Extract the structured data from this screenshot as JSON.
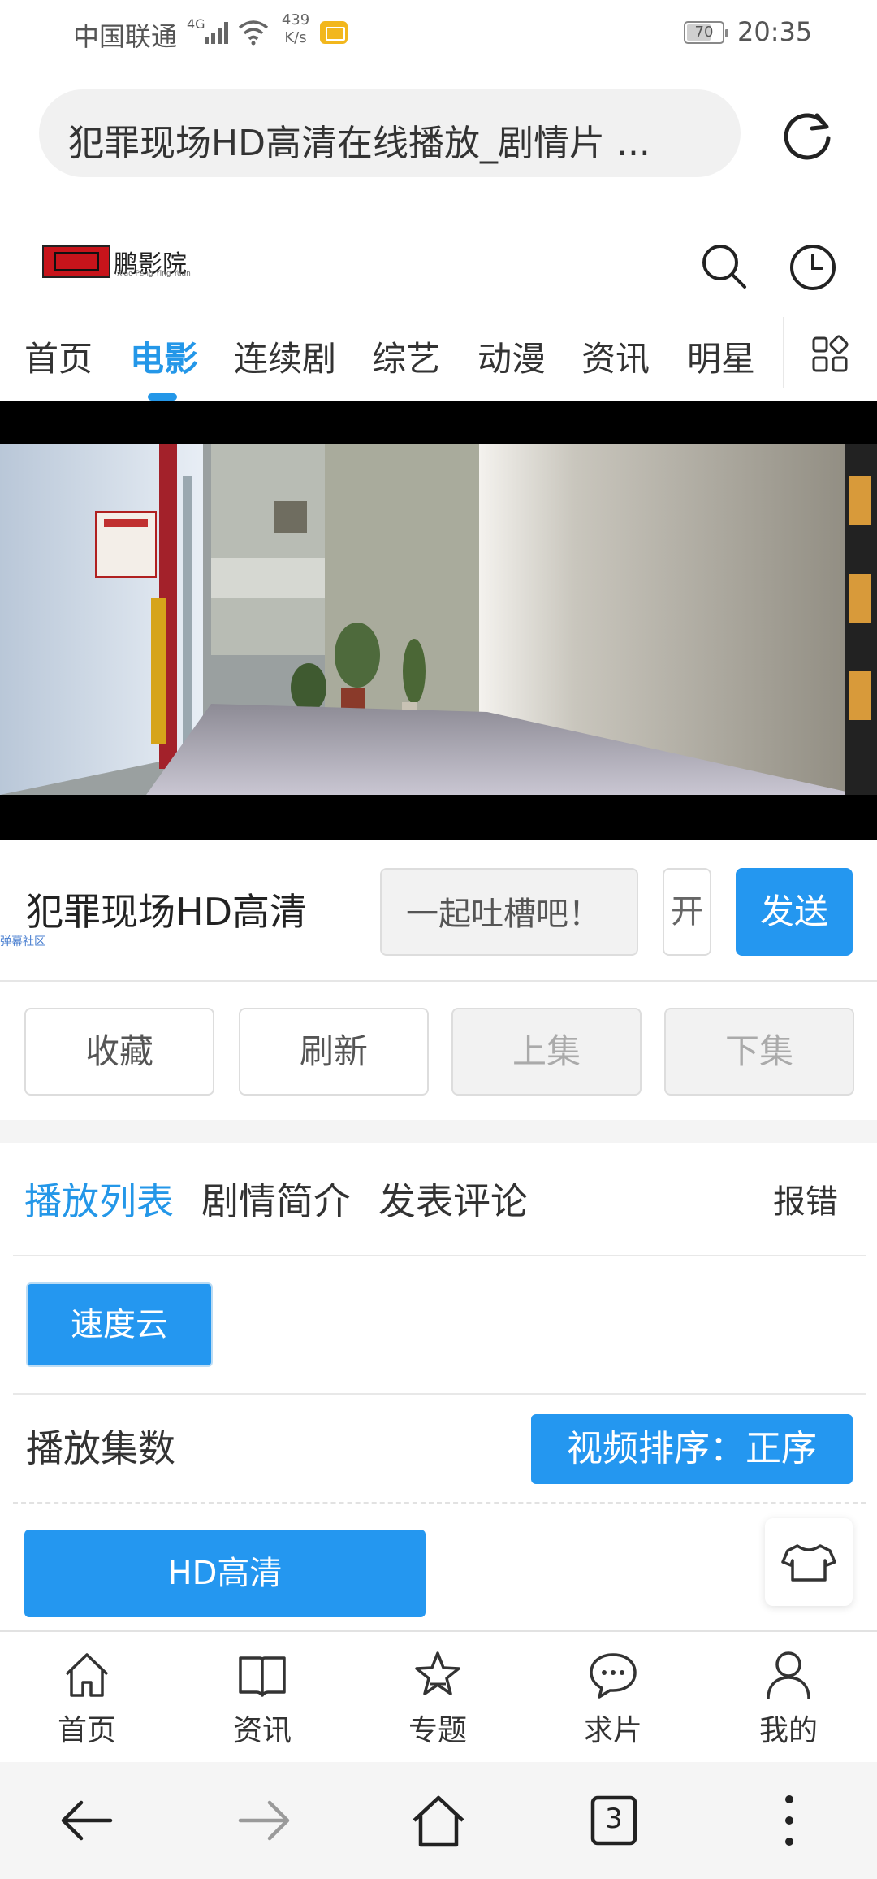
{
  "status_bar": {
    "carrier": "中国联通",
    "network": "4G",
    "speed": "439\nK/s",
    "battery": "70",
    "battery_level": 0.7,
    "time": "20:35"
  },
  "browser": {
    "address_text": "犯罪现场HD高清在线播放_剧情片 ...",
    "refresh_icon": "refresh-icon",
    "tab_count": "3"
  },
  "site": {
    "logo_text": "鹏影院",
    "logo_subtext": "Xiao Peng Ying Yuan",
    "search_icon": "search-icon",
    "history_icon": "history-icon"
  },
  "nav": {
    "items": [
      "首页",
      "电影",
      "连续剧",
      "综艺",
      "动漫",
      "资讯",
      "明星"
    ],
    "active_index": 1,
    "accent_color": "#2497e8"
  },
  "player": {
    "title": "犯罪现场HD高清",
    "danmaku_tag": "弹幕社区",
    "danmaku_placeholder": "一起吐槽吧！",
    "danmaku_toggle": "开",
    "send_label": "发送"
  },
  "actions": {
    "favorite": "收藏",
    "refresh": "刷新",
    "prev": "上集",
    "next": "下集"
  },
  "tabs": {
    "items": [
      "播放列表",
      "剧情简介",
      "发表评论"
    ],
    "active_index": 0,
    "report": "报错"
  },
  "playlist": {
    "source": "速度云",
    "episodes_label": "播放集数",
    "sort_label": "视频排序：正序",
    "episodes": [
      "HD高清"
    ]
  },
  "tabbar": {
    "items": [
      {
        "label": "首页",
        "icon": "home-icon"
      },
      {
        "label": "资讯",
        "icon": "book-icon"
      },
      {
        "label": "专题",
        "icon": "star-icon"
      },
      {
        "label": "求片",
        "icon": "chat-icon"
      },
      {
        "label": "我的",
        "icon": "user-icon"
      }
    ]
  },
  "colors": {
    "primary": "#2497f0",
    "text": "#333333",
    "disabled_bg": "#f2f2f2"
  }
}
